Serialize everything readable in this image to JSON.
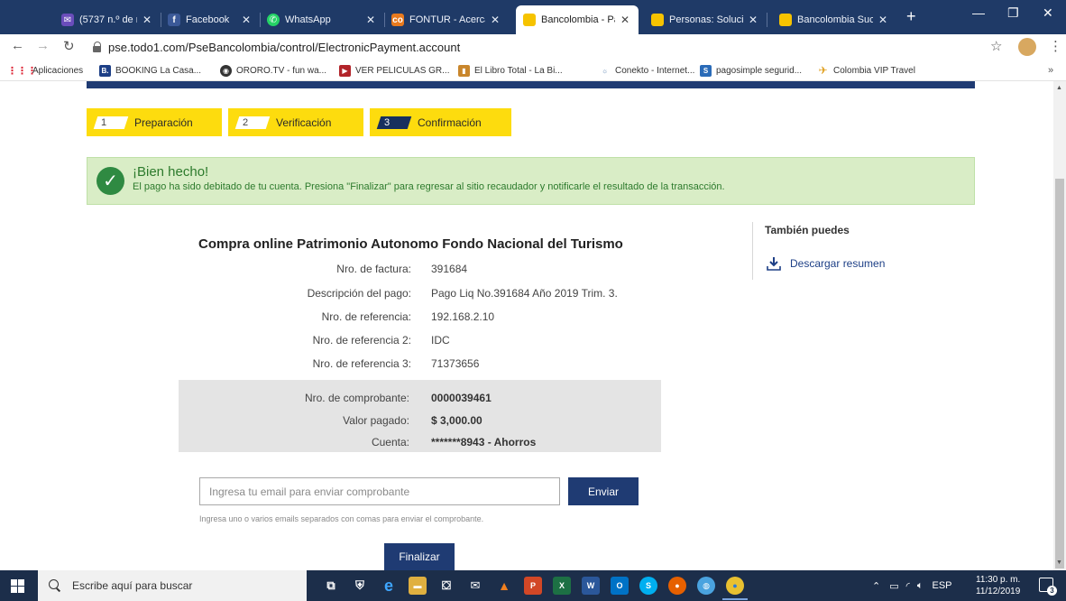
{
  "browser": {
    "tabs": [
      {
        "label": "(5737 n.º de no le",
        "icon": "envelope-icon",
        "active": false
      },
      {
        "label": "Facebook",
        "icon": "facebook-icon",
        "active": false
      },
      {
        "label": "WhatsApp",
        "icon": "whatsapp-icon",
        "active": false
      },
      {
        "label": "FONTUR - Acerca",
        "icon": "fontur-icon",
        "active": false
      },
      {
        "label": "Bancolombia - Pa",
        "icon": "bancolombia-icon",
        "active": true
      },
      {
        "label": "Personas: Solucion",
        "icon": "bancolombia-icon",
        "active": false
      },
      {
        "label": "Bancolombia Sucu",
        "icon": "bancolombia-icon",
        "active": false
      }
    ],
    "url": "pse.todo1.com/PseBancolombia/control/ElectronicPayment.account",
    "bookmarks": [
      {
        "label": "Aplicaciones",
        "icon": "apps-grid-icon"
      },
      {
        "label": "BOOKING La Casa...",
        "icon": "booking-icon"
      },
      {
        "label": "ORORO.TV - fun wa...",
        "icon": "ororo-icon"
      },
      {
        "label": "VER PELICULAS GR...",
        "icon": "movies-icon"
      },
      {
        "label": "El Libro Total - La Bi...",
        "icon": "book-icon"
      },
      {
        "label": "Conekto - Internet...",
        "icon": "conekto-icon"
      },
      {
        "label": "pagosimple segurid...",
        "icon": "pagosimple-icon"
      },
      {
        "label": "Colombia VIP Travel",
        "icon": "travel-icon"
      }
    ],
    "bookmarks_more": "»"
  },
  "steps": [
    {
      "number": "1",
      "label": "Preparación",
      "current": false
    },
    {
      "number": "2",
      "label": "Verificación",
      "current": false
    },
    {
      "number": "3",
      "label": "Confirmación",
      "current": true
    }
  ],
  "alert": {
    "title": "¡Bien hecho!",
    "message": "El pago ha sido debitado de tu cuenta. Presiona \"Finalizar\" para regresar al sitio recaudador y notificarle el resultado de la transacción."
  },
  "receipt": {
    "title": "Compra online Patrimonio Autonomo Fondo Nacional del Turismo",
    "rows": [
      {
        "label": "Nro. de factura:",
        "value": "391684"
      },
      {
        "label": "Descripción del pago:",
        "value": "Pago Liq No.391684 Año 2019 Trim. 3."
      },
      {
        "label": "Nro. de referencia:",
        "value": "192.168.2.10"
      },
      {
        "label": "Nro. de referencia 2:",
        "value": "IDC"
      },
      {
        "label": "Nro. de referencia 3:",
        "value": "71373656"
      }
    ],
    "summary": [
      {
        "label": "Nro. de comprobante:",
        "value": "0000039461"
      },
      {
        "label": "Valor pagado:",
        "value": "$ 3,000.00"
      },
      {
        "label": "Cuenta:",
        "value": "*******8943 - Ahorros"
      }
    ]
  },
  "aside": {
    "title": "También puedes",
    "download_label": "Descargar resumen"
  },
  "email": {
    "placeholder": "Ingresa tu email para enviar comprobante",
    "send_label": "Enviar",
    "hint": "Ingresa uno o varios emails separados con comas para enviar el comprobante."
  },
  "finish_label": "Finalizar",
  "taskbar": {
    "search_placeholder": "Escribe aquí para buscar",
    "language": "ESP",
    "time": "11:30 p. m.",
    "date": "11/12/2019",
    "notifications": "3"
  },
  "colors": {
    "brand_navy": "#1f3b73",
    "step_yellow": "#fddc0e",
    "success_bg": "#d9edc6",
    "success_text": "#2c7a2c"
  }
}
